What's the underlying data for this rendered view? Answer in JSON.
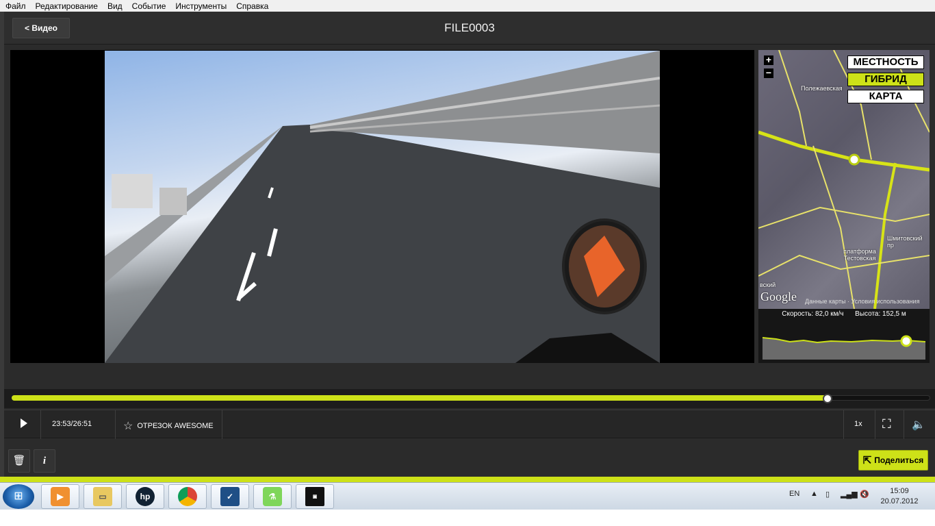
{
  "menu": [
    "Файл",
    "Редактирование",
    "Вид",
    "Событие",
    "Инструменты",
    "Справка"
  ],
  "header": {
    "back_label": "< Видео",
    "title": "FILE0003"
  },
  "map": {
    "buttons": [
      "МЕСТНОСТЬ",
      "ГИБРИД",
      "КАРТА"
    ],
    "active_button": "ГИБРИД",
    "zoom_in": "+",
    "zoom_out": "−",
    "labels": [
      "Полежаевская",
      "платформа Тестовская",
      "Шмитовский пр",
      "вский"
    ],
    "google": "Google",
    "terms": "Данные карты · Условия использования",
    "speed": "Скорость: 82,0 км/ч",
    "altitude": "Высота: 152,5 м"
  },
  "player": {
    "time": "23:53/26:51",
    "segment": "ОТРЕЗОК AWESOME",
    "speed": "1x",
    "progress": 0.885
  },
  "bottom": {
    "share_label": "Поделиться"
  },
  "taskbar": {
    "apps": [
      "media-player",
      "file-explorer",
      "hp",
      "chrome",
      "check-app",
      "lab-app",
      "storyteller"
    ],
    "lang": "EN",
    "time": "15:09",
    "date": "20.07.2012"
  },
  "colors": {
    "accent": "#cde118",
    "app_bg": "#2b2b2b"
  }
}
